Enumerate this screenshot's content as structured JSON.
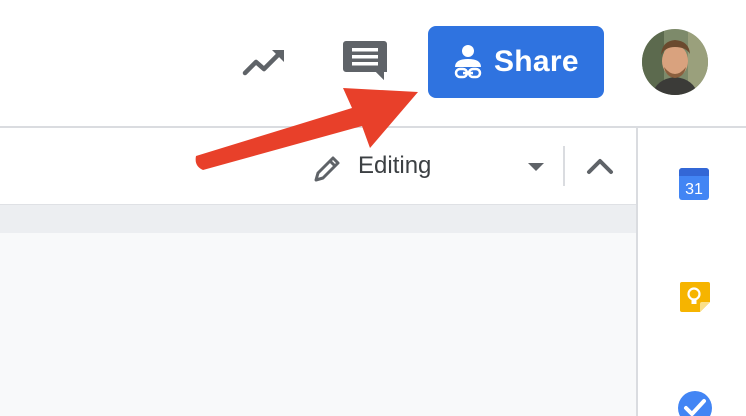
{
  "header": {
    "share_label": "Share",
    "icons": {
      "activity": "trending-up-icon",
      "comments": "comments-icon",
      "share": "person-link-icon",
      "avatar": "user-avatar"
    },
    "share_color": "#2f73e0"
  },
  "toolbar": {
    "mode_label": "Editing",
    "icons": {
      "mode": "pencil-icon",
      "caret": "caret-down-icon",
      "collapse": "chevron-up-icon"
    }
  },
  "side_panel": {
    "calendar_date": "31",
    "apps": [
      "calendar-icon",
      "keep-icon",
      "tasks-icon"
    ]
  },
  "annotation": {
    "arrow_color": "#e8402a",
    "points_to": "share-button"
  }
}
